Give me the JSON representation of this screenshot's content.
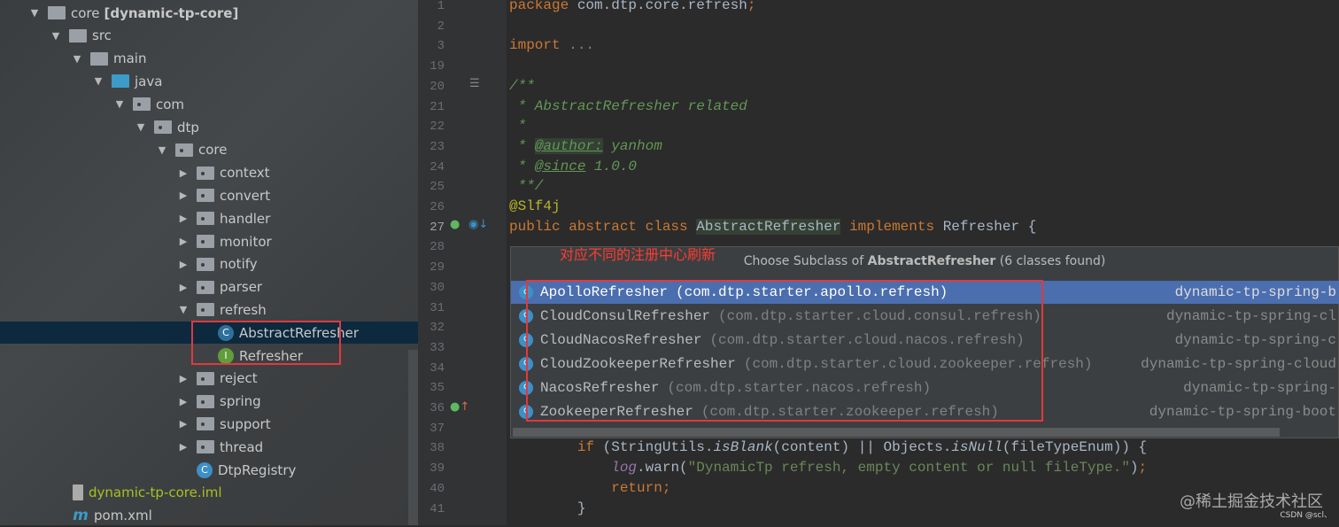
{
  "project_tree": {
    "items": [
      {
        "label": "core",
        "suffix": "[dynamic-tp-core]",
        "depth": 0,
        "expanded": true,
        "icon": "module-folder-icon"
      },
      {
        "label": "src",
        "depth": 1,
        "expanded": true,
        "icon": "folder-icon"
      },
      {
        "label": "main",
        "depth": 2,
        "expanded": true,
        "icon": "folder-icon"
      },
      {
        "label": "java",
        "depth": 3,
        "expanded": true,
        "icon": "source-folder-icon"
      },
      {
        "label": "com",
        "depth": 4,
        "expanded": true,
        "icon": "package-icon"
      },
      {
        "label": "dtp",
        "depth": 5,
        "expanded": true,
        "icon": "package-icon"
      },
      {
        "label": "core",
        "depth": 6,
        "expanded": true,
        "icon": "package-icon"
      },
      {
        "label": "context",
        "depth": 7,
        "expanded": false,
        "icon": "package-icon"
      },
      {
        "label": "convert",
        "depth": 7,
        "expanded": false,
        "icon": "package-icon"
      },
      {
        "label": "handler",
        "depth": 7,
        "expanded": false,
        "icon": "package-icon"
      },
      {
        "label": "monitor",
        "depth": 7,
        "expanded": false,
        "icon": "package-icon"
      },
      {
        "label": "notify",
        "depth": 7,
        "expanded": false,
        "icon": "package-icon"
      },
      {
        "label": "parser",
        "depth": 7,
        "expanded": false,
        "icon": "package-icon"
      },
      {
        "label": "refresh",
        "depth": 7,
        "expanded": true,
        "icon": "package-icon"
      },
      {
        "label": "AbstractRefresher",
        "depth": 8,
        "icon": "abstract-class-icon",
        "selected": true
      },
      {
        "label": "Refresher",
        "depth": 8,
        "icon": "interface-icon"
      },
      {
        "label": "reject",
        "depth": 7,
        "expanded": false,
        "icon": "package-icon"
      },
      {
        "label": "spring",
        "depth": 7,
        "expanded": false,
        "icon": "package-icon"
      },
      {
        "label": "support",
        "depth": 7,
        "expanded": false,
        "icon": "package-icon"
      },
      {
        "label": "thread",
        "depth": 7,
        "expanded": false,
        "icon": "package-icon"
      },
      {
        "label": "DtpRegistry",
        "depth": 7,
        "icon": "class-icon"
      },
      {
        "label": "dynamic-tp-core.iml",
        "depth": 2,
        "icon": "iml-file-icon",
        "color": "#a8c023"
      },
      {
        "label": "pom.xml",
        "depth": 2,
        "icon": "maven-icon"
      }
    ]
  },
  "editor": {
    "lines": [
      {
        "num": "1",
        "tokens": [
          {
            "t": "package ",
            "c": "kw"
          },
          {
            "t": "com.dtp.core.refresh",
            "c": ""
          },
          {
            "t": ";",
            "c": "kw"
          }
        ]
      },
      {
        "num": "2",
        "tokens": []
      },
      {
        "num": "3",
        "tokens": [
          {
            "t": "import ",
            "c": "kw"
          },
          {
            "t": "...",
            "c": "fd"
          }
        ]
      },
      {
        "num": "19",
        "tokens": []
      },
      {
        "num": "20",
        "tokens": [
          {
            "t": "/**",
            "c": "cm"
          }
        ]
      },
      {
        "num": "21",
        "tokens": [
          {
            "t": " * AbstractRefresher related",
            "c": "cm"
          }
        ]
      },
      {
        "num": "22",
        "tokens": [
          {
            "t": " *",
            "c": "cm"
          }
        ]
      },
      {
        "num": "23",
        "tokens": [
          {
            "t": " * ",
            "c": "cm"
          },
          {
            "t": "@author:",
            "c": "tag hl"
          },
          {
            "t": " yanhom",
            "c": "cm"
          }
        ]
      },
      {
        "num": "24",
        "tokens": [
          {
            "t": " * ",
            "c": "cm"
          },
          {
            "t": "@since",
            "c": "tag"
          },
          {
            "t": " 1.0.0",
            "c": "cm"
          }
        ]
      },
      {
        "num": "25",
        "tokens": [
          {
            "t": " **/",
            "c": "cm"
          }
        ]
      },
      {
        "num": "26",
        "tokens": [
          {
            "t": "@Slf4j",
            "c": "ann"
          }
        ]
      },
      {
        "num": "27",
        "tokens": [
          {
            "t": "public abstract class ",
            "c": "kw"
          },
          {
            "t": "AbstractRefresher",
            "c": "hl"
          },
          {
            "t": " implements ",
            "c": "kw"
          },
          {
            "t": "Refresher {",
            "c": ""
          }
        ]
      },
      {
        "num": "28",
        "tokens": []
      },
      {
        "num": "29",
        "tokens": []
      },
      {
        "num": "30",
        "tokens": []
      },
      {
        "num": "31",
        "tokens": []
      },
      {
        "num": "32",
        "tokens": []
      },
      {
        "num": "33",
        "tokens": []
      },
      {
        "num": "34",
        "tokens": []
      },
      {
        "num": "35",
        "tokens": []
      },
      {
        "num": "36",
        "tokens": []
      },
      {
        "num": "37",
        "tokens": []
      },
      {
        "num": "38",
        "tokens": [
          {
            "t": "        if ",
            "c": "kw"
          },
          {
            "t": "(StringUtils.",
            "c": ""
          },
          {
            "t": "isBlank",
            "c": "it"
          },
          {
            "t": "(content) || Objects.",
            "c": ""
          },
          {
            "t": "isNull",
            "c": "it"
          },
          {
            "t": "(fileTypeEnum)) {",
            "c": ""
          }
        ]
      },
      {
        "num": "39",
        "tokens": [
          {
            "t": "            ",
            "c": ""
          },
          {
            "t": "log",
            "c": "lg"
          },
          {
            "t": ".warn(",
            "c": ""
          },
          {
            "t": "\"DynamicTp refresh, empty content or null fileType.\"",
            "c": "str"
          },
          {
            "t": ")",
            "c": ""
          },
          {
            "t": ";",
            "c": "kw"
          }
        ]
      },
      {
        "num": "40",
        "tokens": [
          {
            "t": "            return;",
            "c": "kw"
          }
        ]
      },
      {
        "num": "41",
        "tokens": [
          {
            "t": "        }",
            "c": ""
          }
        ]
      }
    ]
  },
  "popup": {
    "title_prefix": "Choose Subclass of ",
    "title_class": "AbstractRefresher",
    "title_suffix": " (6 classes found)",
    "items": [
      {
        "name": "ApolloRefresher",
        "package": "(com.dtp.starter.apollo.refresh)",
        "module": "dynamic-tp-spring-b",
        "selected": true
      },
      {
        "name": "CloudConsulRefresher",
        "package": "(com.dtp.starter.cloud.consul.refresh)",
        "module": "dynamic-tp-spring-cl"
      },
      {
        "name": "CloudNacosRefresher",
        "package": "(com.dtp.starter.cloud.nacos.refresh)",
        "module": "dynamic-tp-spring-c"
      },
      {
        "name": "CloudZookeeperRefresher",
        "package": "(com.dtp.starter.cloud.zookeeper.refresh)",
        "module": "dynamic-tp-spring-cloud"
      },
      {
        "name": "NacosRefresher",
        "package": "(com.dtp.starter.nacos.refresh)",
        "module": "dynamic-tp-spring-"
      },
      {
        "name": "ZookeeperRefresher",
        "package": "(com.dtp.starter.zookeeper.refresh)",
        "module": "dynamic-tp-spring-boot"
      }
    ]
  },
  "annotation": {
    "note": "对应不同的注册中心刷新",
    "color": "#e0393e"
  },
  "watermark": {
    "main": "@稀土掘金技术社区",
    "sub": "CSDN @scl、"
  }
}
